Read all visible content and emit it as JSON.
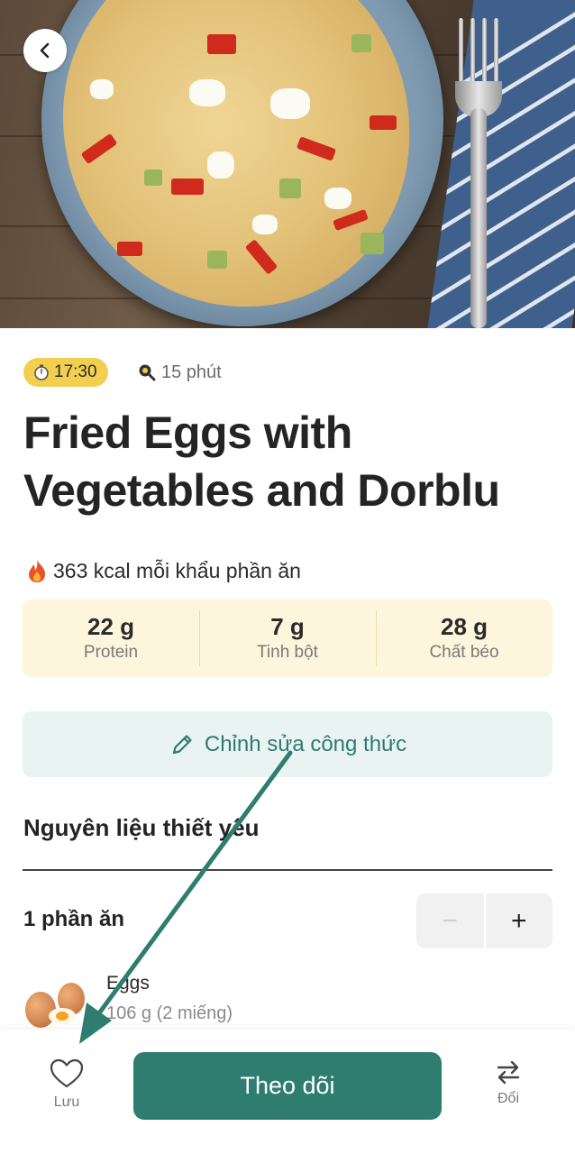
{
  "header": {
    "back_icon": "chevron-left-icon"
  },
  "meta": {
    "time": "17:30",
    "time_icon": "stopwatch-icon",
    "duration": "15 phút",
    "duration_icon": "cooking-pan-icon"
  },
  "recipe": {
    "title": "Fried Eggs with Vegetables and Dorblu",
    "calories": "363 kcal mỗi khẩu phần ăn",
    "calories_icon": "fire-icon"
  },
  "macros": [
    {
      "value": "22 g",
      "label": "Protein"
    },
    {
      "value": "7 g",
      "label": "Tinh bột"
    },
    {
      "value": "28 g",
      "label": "Chất béo"
    }
  ],
  "edit": {
    "label": "Chỉnh sửa công thức",
    "icon": "pencil-icon"
  },
  "ingredients": {
    "section_title": "Nguyên liệu thiết yếu",
    "servings_label": "1 phần ăn",
    "stepper": {
      "minus": "−",
      "plus": "+"
    },
    "items": [
      {
        "name": "Eggs",
        "quantity": "106 g (2 miếng)"
      }
    ]
  },
  "bottom_bar": {
    "save_label": "Lưu",
    "follow_label": "Theo dõi",
    "swap_label": "Đổi"
  },
  "colors": {
    "accent": "#2e7d70",
    "time_badge": "#f2cf4f",
    "macro_bg": "#fdf5dc",
    "edit_bg": "#e9f4f2"
  }
}
